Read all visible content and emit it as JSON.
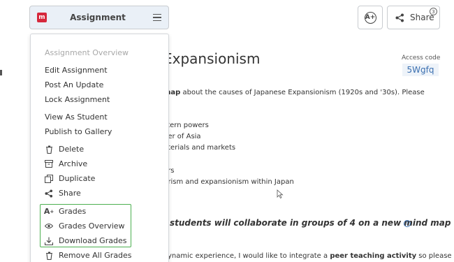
{
  "header": {
    "assignment_title": "Assignment",
    "logo_text": "m",
    "share_label": "Share",
    "share_count": "3",
    "grade_icon_text": "A+"
  },
  "page": {
    "title_partial": "Expansionism",
    "access_code_label": "Access code",
    "access_code": "5Wgfq",
    "intro_bold": "map",
    "intro_rest": " about the causes of Japanese Expansionism (1920s and '30s). Please",
    "bullets": [
      "stern powers",
      "der of Asia",
      "aterials and markets",
      "ers",
      "urism and expansionism within Japan"
    ],
    "collab_text": "students will collaborate in groups of 4 on a new mind map",
    "bottom_pre": "ynamic experience, I would like to integrate a ",
    "bottom_bold": "peer teaching activity",
    "bottom_post": " so please"
  },
  "menu": {
    "overview": "Assignment Overview",
    "edit": "Edit Assignment",
    "post_update": "Post An Update",
    "lock": "Lock Assignment",
    "view_as_student": "View As Student",
    "publish": "Publish to Gallery",
    "delete": "Delete",
    "archive": "Archive",
    "duplicate": "Duplicate",
    "share": "Share",
    "grades": "Grades",
    "grades_overview": "Grades Overview",
    "download_grades": "Download Grades",
    "remove_all_grades": "Remove All Grades"
  },
  "colors": {
    "brand": "#d6283c",
    "highlight_box": "#4caf50",
    "link": "#3a6fb0"
  },
  "icons": {
    "logo": "mindomo-logo-icon",
    "menu": "hamburger-icon",
    "grade": "grade-a-plus-icon",
    "share": "share-icon",
    "trash": "trash-icon",
    "archive": "archive-icon",
    "duplicate": "duplicate-icon",
    "eye": "eye-icon",
    "download": "download-icon",
    "help": "help-icon"
  }
}
